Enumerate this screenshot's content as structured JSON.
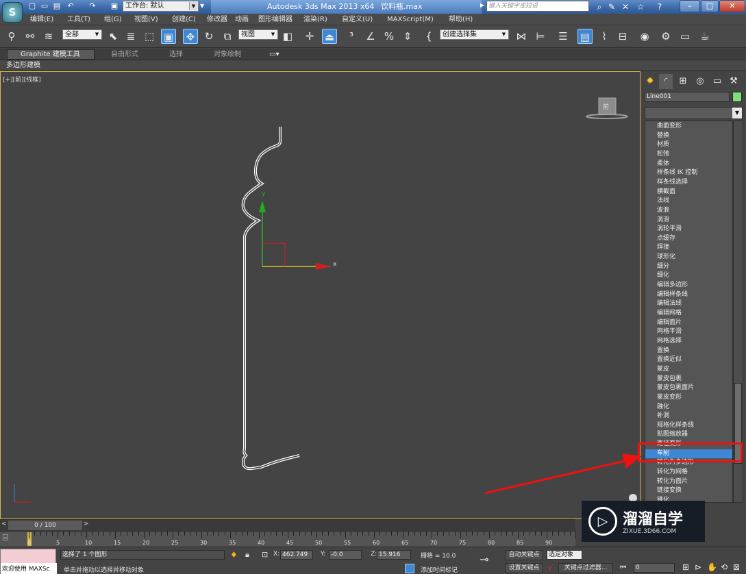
{
  "app": {
    "title": "Autodesk 3ds Max  2013 x64",
    "filename": "饮料瓶.max",
    "workspace": "工作台: 默认",
    "search_placeholder": "键入关键字或短语",
    "logo": "S"
  },
  "menu": [
    "编辑(E)",
    "工具(T)",
    "组(G)",
    "视图(V)",
    "创建(C)",
    "修改器",
    "动画",
    "图形编辑器",
    "渲染(R)",
    "自定义(U)",
    "MAXScript(M)",
    "帮助(H)"
  ],
  "toolbar": {
    "selection_filter": "全部",
    "ref_coord": "视图",
    "named_selection": "创建选择集"
  },
  "ribbon": {
    "tabs": [
      "Graphite 建模工具",
      "自由形式",
      "选择",
      "对象绘制"
    ],
    "sub": "多边形建模"
  },
  "viewport": {
    "label": "[+][前][线框]",
    "viewcube": "前",
    "axis_x": "x",
    "axis_y": "y"
  },
  "panel": {
    "object_name": "Line001",
    "modifiers": [
      "曲面变形",
      "替换",
      "材质",
      "松弛",
      "柔体",
      "样条线 IK 控制",
      "样条线选择",
      "横截面",
      "法线",
      "波浪",
      "涡滑",
      "涡轮平滑",
      "点缓存",
      "焊接",
      "球形化",
      "细分",
      "细化",
      "编辑多边形",
      "编辑样条线",
      "编辑法线",
      "编辑网格",
      "编辑面片",
      "网格平滑",
      "网格选择",
      "置换",
      "置换近似",
      "蒙皮",
      "蒙皮包裹",
      "蒙皮包裹面片",
      "蒙皮变形",
      "融化",
      "补洞",
      "规格化样条线",
      "贴图缩放器",
      "路径变形",
      "车削",
      "转化为多边形",
      "转化为网格",
      "转化为面片",
      "链接变换",
      "锥化"
    ],
    "selected_modifier": "车削"
  },
  "timeline": {
    "frame": "0 / 100",
    "ticks": [
      "0",
      "5",
      "10",
      "15",
      "20",
      "25",
      "30",
      "35",
      "40",
      "45",
      "50",
      "55",
      "60",
      "65",
      "70",
      "75",
      "80",
      "85",
      "90"
    ]
  },
  "status": {
    "maxscript": "欢迎使用 MAXSc",
    "selected": "选择了 1 个图形",
    "prompt": "单击并拖动以选择并移动对象",
    "x_label": "X:",
    "x": "462.749",
    "y_label": "Y:",
    "y": "-0.0",
    "z_label": "Z:",
    "z": "15.916",
    "grid": "栅格 = 10.0",
    "auto_key": "自动关键点",
    "selected_object": "选定对象",
    "set_key": "设置关键点",
    "key_filter": "关键点过滤器...",
    "add_time_tag": "添加时间标记",
    "frame_field": "0"
  },
  "watermark": {
    "title": "溜溜自学",
    "url": "ZIXUE.3D66.COM"
  }
}
